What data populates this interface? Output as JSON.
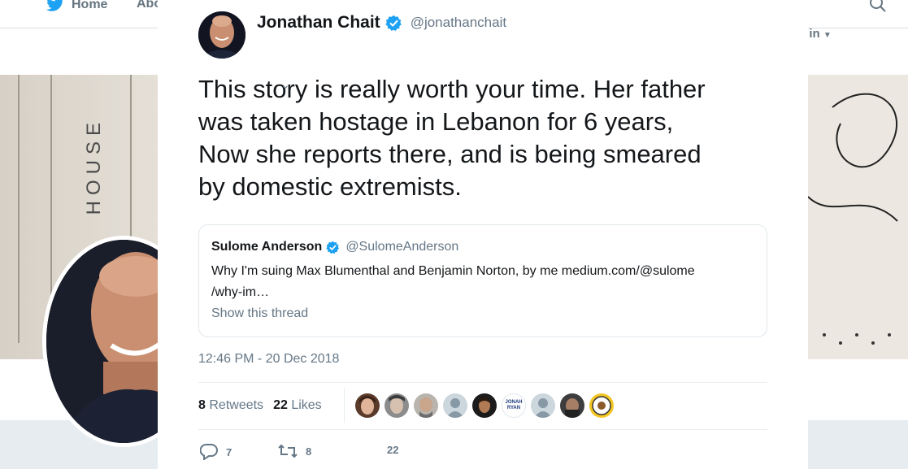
{
  "background": {
    "nav": {
      "home_label": "Home",
      "about_label": "Abo",
      "login_label": "g in"
    },
    "cover_text": "HOUSE"
  },
  "tweet": {
    "author": {
      "name": "Jonathan Chait",
      "handle": "@jonathanchait"
    },
    "text_lines": [
      "This story is really worth your time. Her father",
      "was taken hostage in Lebanon for 6 years,",
      "Now she reports there, and is being smeared",
      "by domestic extremists."
    ],
    "quote": {
      "author_name": "Sulome Anderson",
      "author_handle": "@SulomeAnderson",
      "text_lines": [
        "Why I'm suing Max Blumenthal and Benjamin Norton, by me medium.com/@sulome",
        "/why-im…"
      ],
      "show_thread": "Show this thread"
    },
    "timestamp": "12:46 PM - 20 Dec 2018",
    "stats": {
      "retweets_count": "8",
      "retweets_label": "Retweets",
      "likes_count": "22",
      "likes_label": "Likes"
    },
    "likers": [
      {
        "icon": "liker-avatar-1"
      },
      {
        "icon": "liker-avatar-2"
      },
      {
        "icon": "liker-avatar-3"
      },
      {
        "icon": "liker-avatar-4"
      },
      {
        "icon": "liker-avatar-5"
      },
      {
        "icon": "liker-avatar-jonah-ryan"
      },
      {
        "icon": "liker-avatar-7"
      },
      {
        "icon": "liker-avatar-8"
      },
      {
        "icon": "liker-avatar-9"
      }
    ],
    "liker_badge_text": "JONAH RYAN",
    "actions": {
      "reply_count": "7",
      "retweet_count": "8",
      "like_count": "22"
    }
  },
  "colors": {
    "verified": "#1da1f2",
    "text": "#14171a",
    "secondary": "#657786",
    "twitter_blue": "#1da1f2"
  }
}
